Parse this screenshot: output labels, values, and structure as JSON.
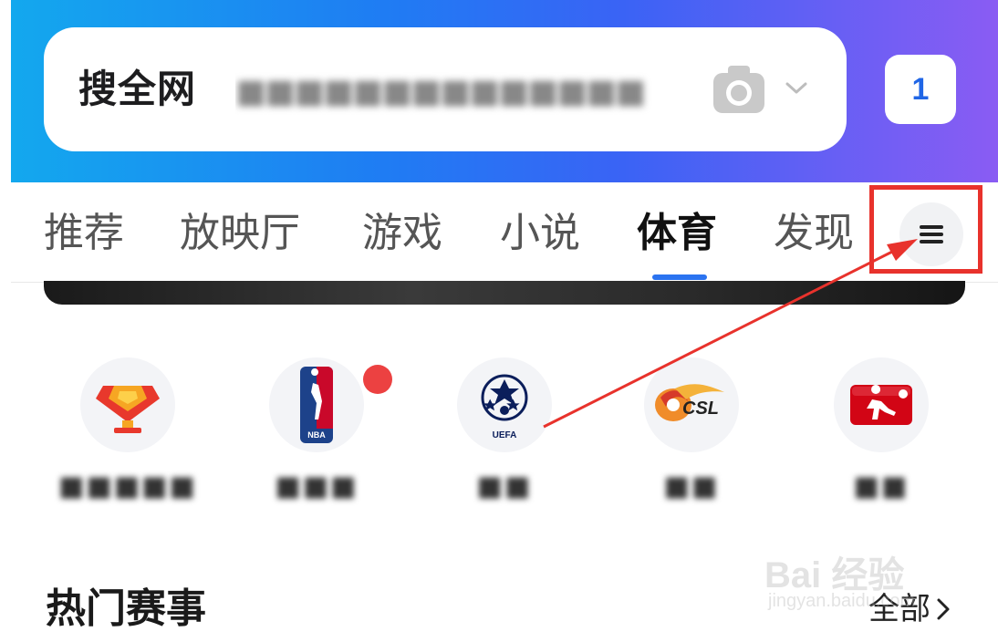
{
  "search": {
    "scope_label": "搜全网",
    "query_obscured": "■■■■■■■■■■■■■■",
    "tab_count": "1"
  },
  "tabs": [
    {
      "label": "推荐",
      "active": false
    },
    {
      "label": "放映厅",
      "active": false
    },
    {
      "label": "游戏",
      "active": false
    },
    {
      "label": "小说",
      "active": false
    },
    {
      "label": "体育",
      "active": true
    },
    {
      "label": "发现",
      "active": false
    }
  ],
  "shortcuts": [
    {
      "label": "■■■■■",
      "icon": "ruby-trophy-icon"
    },
    {
      "label": "■■■",
      "icon": "nba-logo-icon",
      "badge": true
    },
    {
      "label": "■■",
      "icon": "uefa-champions-league-icon"
    },
    {
      "label": "■■",
      "icon": "csl-logo-icon"
    },
    {
      "label": "■■",
      "icon": "bundesliga-logo-icon"
    }
  ],
  "section": {
    "title": "热门赛事",
    "see_all": "全部"
  },
  "watermark": {
    "main": "Bai  经验",
    "sub": "jingyan.baidu.com"
  },
  "colors": {
    "accent": "#2b73f0",
    "annotation": "#e8322c",
    "badge": "#ec4141"
  }
}
